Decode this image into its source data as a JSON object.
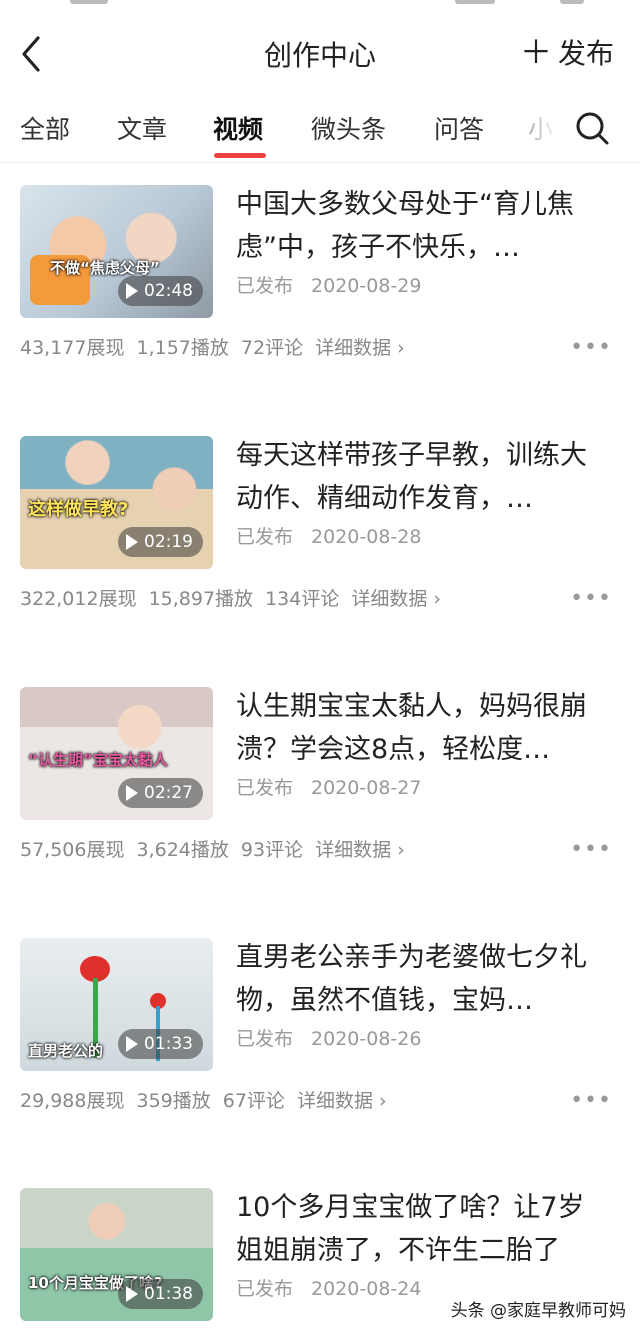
{
  "header": {
    "title": "创作中心",
    "publish_label": "发布"
  },
  "tabs": [
    {
      "label": "全部",
      "active": false
    },
    {
      "label": "文章",
      "active": false
    },
    {
      "label": "视频",
      "active": true
    },
    {
      "label": "微头条",
      "active": false
    },
    {
      "label": "问答",
      "active": false
    },
    {
      "label": "小",
      "active": false
    }
  ],
  "colors": {
    "accent": "#f04142"
  },
  "items": [
    {
      "title": "中国大多数父母处于“育儿焦虑”中，孩子不快乐，…",
      "status": "已发布",
      "date": "2020-08-29",
      "duration": "02:48",
      "thumb_caption": "不做“焦虑父母”",
      "views": "43,177展现",
      "plays": "1,157播放",
      "comments": "72评论",
      "detail": "详细数据 ›"
    },
    {
      "title": "每天这样带孩子早教，训练大动作、精细动作发育，…",
      "status": "已发布",
      "date": "2020-08-28",
      "duration": "02:19",
      "thumb_caption": "这样做早教?",
      "views": "322,012展现",
      "plays": "15,897播放",
      "comments": "134评论",
      "detail": "详细数据 ›"
    },
    {
      "title": "认生期宝宝太黏人，妈妈很崩溃？学会这8点，轻松度…",
      "status": "已发布",
      "date": "2020-08-27",
      "duration": "02:27",
      "thumb_caption": "“认生期”宝宝太黏人",
      "views": "57,506展现",
      "plays": "3,624播放",
      "comments": "93评论",
      "detail": "详细数据 ›"
    },
    {
      "title": "直男老公亲手为老婆做七夕礼物，虽然不值钱，宝妈…",
      "status": "已发布",
      "date": "2020-08-26",
      "duration": "01:33",
      "thumb_caption": "直男老公的",
      "views": "29,988展现",
      "plays": "359播放",
      "comments": "67评论",
      "detail": "详细数据 ›"
    },
    {
      "title": "10个多月宝宝做了啥？让7岁姐姐崩溃了，不许生二胎了",
      "status": "已发布",
      "date": "2020-08-24",
      "duration": "01:38",
      "thumb_caption": "10个月宝宝做了啥?",
      "views": "",
      "plays": "",
      "comments": "",
      "detail": ""
    }
  ],
  "watermark": "头条 @家庭早教师可妈"
}
